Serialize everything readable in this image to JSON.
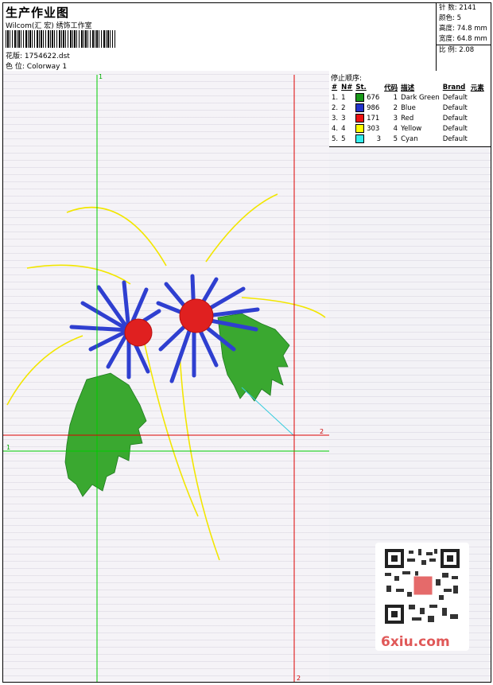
{
  "header": {
    "title": "生产作业图",
    "company": "Wilcom(汇 宏) 绣饰工作室",
    "design_label": "花版:",
    "design_value": "1754622.dst",
    "colorway_label": "色 位:",
    "colorway_value": "Colorway 1"
  },
  "stats": [
    {
      "label": "针 数:",
      "value": "2141"
    },
    {
      "label": "颜色:",
      "value": "5"
    },
    {
      "label": "高度:",
      "value": "74.8 mm"
    },
    {
      "label": "宽度:",
      "value": "64.8 mm"
    },
    {
      "label": "比 例:",
      "value": "2.08"
    }
  ],
  "canvas": {
    "grid_labels": [
      "1",
      "2",
      "2",
      "1"
    ],
    "colors": {
      "green_line": "#00cc00",
      "red_line": "#dd0000",
      "cyan_line": "#33ccdd"
    }
  },
  "stop_sequence": {
    "title": "停止顺序:",
    "columns": [
      "#",
      "N#",
      "St.",
      "代码",
      "描述",
      "Brand",
      "元素"
    ],
    "rows": [
      {
        "num": "1.",
        "n": "1",
        "color": "#1a9a1a",
        "stitches": "676",
        "code": "1",
        "desc": "Dark Green",
        "brand": "Default"
      },
      {
        "num": "2.",
        "n": "2",
        "color": "#2233cc",
        "stitches": "986",
        "code": "2",
        "desc": "Blue",
        "brand": "Default"
      },
      {
        "num": "3.",
        "n": "3",
        "color": "#ee1111",
        "stitches": "171",
        "code": "3",
        "desc": "Red",
        "brand": "Default"
      },
      {
        "num": "4.",
        "n": "4",
        "color": "#ffff00",
        "stitches": "303",
        "code": "4",
        "desc": "Yellow",
        "brand": "Default"
      },
      {
        "num": "5.",
        "n": "5",
        "color": "#33eeee",
        "stitches": "3",
        "code": "5",
        "desc": "Cyan",
        "brand": "Default"
      }
    ]
  },
  "watermark": {
    "text": "6xiu.com"
  }
}
